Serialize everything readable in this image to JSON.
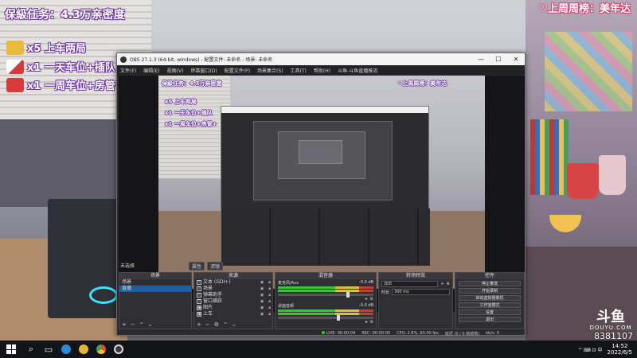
{
  "overlay": {
    "title": "保級任务：4.3万亲密度",
    "top_rank": "♡上周周榜：美年达",
    "items": [
      {
        "label": "x5 上车两局",
        "icon_color": "#e8b93c",
        "icon": "ticket-icon"
      },
      {
        "label": "x1 一天车位+插队",
        "icon_color": "#ffffff",
        "icon": "plane-icon"
      },
      {
        "label": "x1 一周车位+房管+",
        "icon_color": "#d43b3b",
        "icon": "rocket-icon"
      }
    ],
    "douyu_logo": "斗鱼",
    "douyu_sub": "DOUYU.COM",
    "room_id": "8381107"
  },
  "obs": {
    "title": "OBS 27.1.3 (64-bit, windows) - 配置文件: 未命名 - 场景: 未命名",
    "window_controls": [
      "—",
      "☐",
      "✕"
    ],
    "menu": [
      "文件(F)",
      "编辑(E)",
      "视图(V)",
      "停靠窗口(D)",
      "配置文件(P)",
      "场景集合(S)",
      "工具(T)",
      "帮助(H)",
      "斗鱼-斗鱼直播推流"
    ],
    "preview_overlay": {
      "title": "保級任务：4.3万亲密度",
      "top_rank": "♡上周周榜：美年达",
      "items": [
        "x5 上车两局",
        "x1 一天车位+插队",
        "x1 一周车位+房管+"
      ]
    },
    "stage_label": "未选择",
    "stage_buttons": [
      "属性",
      "滤镜"
    ],
    "docks": {
      "scenes": {
        "header": "场景",
        "items": [
          "场景",
          "直播"
        ],
        "selected": 1
      },
      "sources": {
        "header": "来源",
        "items": [
          {
            "label": "文本 (GDI+)",
            "icon": "T"
          },
          {
            "label": "场景",
            "icon": "T"
          },
          {
            "label": "弹幕助手",
            "icon": "T"
          },
          {
            "label": "窗口捕获",
            "icon": "T"
          },
          {
            "label": "图片",
            "icon": "▣"
          },
          {
            "label": "上车",
            "icon": "▣"
          }
        ]
      },
      "mixer": {
        "header": "混音器",
        "channels": [
          {
            "name": "麦克风/Aux",
            "db": "-0.0 dB",
            "level": 0.72
          },
          {
            "name": "桌面音频",
            "db": "-0.0 dB",
            "level": 0.62
          }
        ]
      },
      "transitions": {
        "header": "转场特效",
        "type": "淡出",
        "duration_label": "时长",
        "duration": "300 ms"
      },
      "controls": {
        "header": "控件",
        "buttons": [
          "停止推流",
          "开始录制",
          "启动虚拟摄像机",
          "工作室模式",
          "设置",
          "退出"
        ]
      }
    },
    "status": {
      "live_label": "LIVE:",
      "live_time": "00:00:04",
      "rec_label": "REC:",
      "rec_time": "00:00:00",
      "cpu": "CPU: 2.6%, 60.00 fps",
      "dropped": "延迟 (0 / 0 帧掉落)",
      "kbps": "kb/s: 0"
    }
  },
  "taskbar": {
    "icons": [
      {
        "name": "search-icon",
        "glyph": "⌕"
      },
      {
        "name": "task-view-icon",
        "glyph": "▭"
      },
      {
        "name": "edge-icon",
        "color": "#2d8ad8"
      },
      {
        "name": "taskbar-app-yellow-icon",
        "color": "#e6b530"
      },
      {
        "name": "chrome-icon",
        "color": "#e24a3a"
      },
      {
        "name": "obs-icon",
        "color": "#3a3a3a"
      }
    ],
    "tray": "^ ⌨ ⊡ 中",
    "time": "14:52",
    "date": "2022/6/5"
  }
}
